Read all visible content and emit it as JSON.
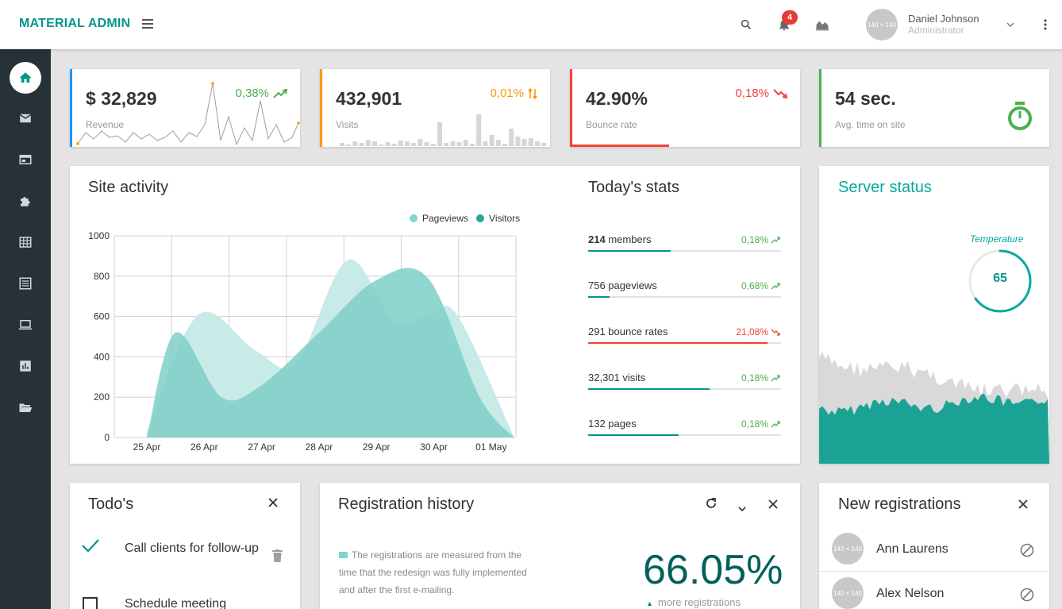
{
  "brand": "MATERIAL ADMIN",
  "header": {
    "notification_count": "4",
    "user_name": "Daniel Johnson",
    "user_role": "Administrator",
    "avatar_text": "140 × 140"
  },
  "sidebar": {
    "items": [
      {
        "icon": "home-icon",
        "active": true
      },
      {
        "icon": "mail-icon"
      },
      {
        "icon": "browser-window-icon"
      },
      {
        "icon": "puzzle-icon"
      },
      {
        "icon": "table-icon"
      },
      {
        "icon": "list-icon"
      },
      {
        "icon": "laptop-icon"
      },
      {
        "icon": "bar-chart-icon"
      },
      {
        "icon": "folder-open-icon"
      }
    ]
  },
  "stats": [
    {
      "value": "$ 32,829",
      "label": "Revenue",
      "change": "0,38%",
      "color": "#4caf50",
      "accent": "#2196f3",
      "icon": "trending-up-icon"
    },
    {
      "value": "432,901",
      "label": "Visits",
      "change": "0,01%",
      "color": "#ff9800",
      "accent": "#ff9800",
      "icon": "swap-vert-icon"
    },
    {
      "value": "42.90%",
      "label": "Bounce rate",
      "change": "0,18%",
      "color": "#f44336",
      "accent": "#f44336",
      "icon": "trending-down-icon"
    },
    {
      "value": "54 sec.",
      "label": "Avg. time on site",
      "change": "",
      "color": "#4caf50",
      "accent": "#4caf50",
      "icon": "timer-icon"
    }
  ],
  "site_activity": {
    "title": "Site activity",
    "legend": [
      "Pageviews",
      "Visitors"
    ]
  },
  "chart_data": {
    "type": "area",
    "categories": [
      "25 Apr",
      "26 Apr",
      "27 Apr",
      "28 Apr",
      "29 Apr",
      "30 Apr",
      "01 May"
    ],
    "x_labels": [
      "25 Apr",
      "26 Apr",
      "27 Apr",
      "28 Apr",
      "29 Apr",
      "30 Apr",
      "01 May"
    ],
    "y_ticks": [
      "1000",
      "800",
      "600",
      "400",
      "200",
      "0"
    ],
    "ylim": [
      0,
      1000
    ],
    "series": [
      {
        "name": "Pageviews",
        "color": "#c8ebe8",
        "points": [
          [
            0,
            30
          ],
          [
            0.9,
            610
          ],
          [
            1.9,
            430
          ],
          [
            2.6,
            370
          ],
          [
            3.5,
            880
          ],
          [
            4.3,
            580
          ],
          [
            4.9,
            600
          ],
          [
            5.4,
            610
          ],
          [
            6.4,
            0
          ]
        ]
      },
      {
        "name": "Visitors",
        "color": "#7fcfc8",
        "points": [
          [
            0,
            0
          ],
          [
            0.5,
            520
          ],
          [
            1.3,
            200
          ],
          [
            2.0,
            260
          ],
          [
            3.0,
            520
          ],
          [
            4.0,
            780
          ],
          [
            4.9,
            790
          ],
          [
            5.8,
            200
          ],
          [
            6.4,
            0
          ]
        ]
      }
    ],
    "grid": true
  },
  "today_stats": {
    "title": "Today's stats",
    "rows": [
      {
        "bold": "214",
        "label": " members",
        "value": "0,18%",
        "color": "#4caf50",
        "bar_color": "#009688",
        "progress": 0.43,
        "icon": "trending-up-icon"
      },
      {
        "bold": "",
        "label": "756 pageviews",
        "value": "0,68%",
        "color": "#4caf50",
        "bar_color": "#009688",
        "progress": 0.11,
        "icon": "trending-up-icon"
      },
      {
        "bold": "",
        "label": "291 bounce rates",
        "value": "21,08%",
        "color": "#f44336",
        "bar_color": "#f44336",
        "progress": 0.93,
        "icon": "trending-down-icon"
      },
      {
        "bold": "",
        "label": "32,301 visits",
        "value": "0,18%",
        "color": "#4caf50",
        "bar_color": "#009688",
        "progress": 0.63,
        "icon": "trending-up-icon"
      },
      {
        "bold": "",
        "label": "132 pages",
        "value": "0,18%",
        "color": "#4caf50",
        "bar_color": "#009688",
        "progress": 0.47,
        "icon": "trending-up-icon"
      }
    ]
  },
  "server_status": {
    "title": "Server status",
    "temperature_label": "Temperature",
    "temperature_value": "65",
    "gauge_fraction": 0.65
  },
  "todos": {
    "title": "Todo's",
    "items": [
      {
        "text": "Call clients for follow-up",
        "done": true
      },
      {
        "text": "Schedule meeting",
        "done": false
      }
    ]
  },
  "registration_history": {
    "title": "Registration history",
    "description": "The registrations are measured from the time that the redesign was fully implemented and after the first e-mailing.",
    "percentage": "66.05%",
    "subtext": "more registrations"
  },
  "new_registrations": {
    "title": "New registrations",
    "users": [
      {
        "name": "Ann Laurens",
        "avatar_text": "140 × 140"
      },
      {
        "name": "Alex Nelson",
        "avatar_text": "140 × 140"
      }
    ]
  }
}
